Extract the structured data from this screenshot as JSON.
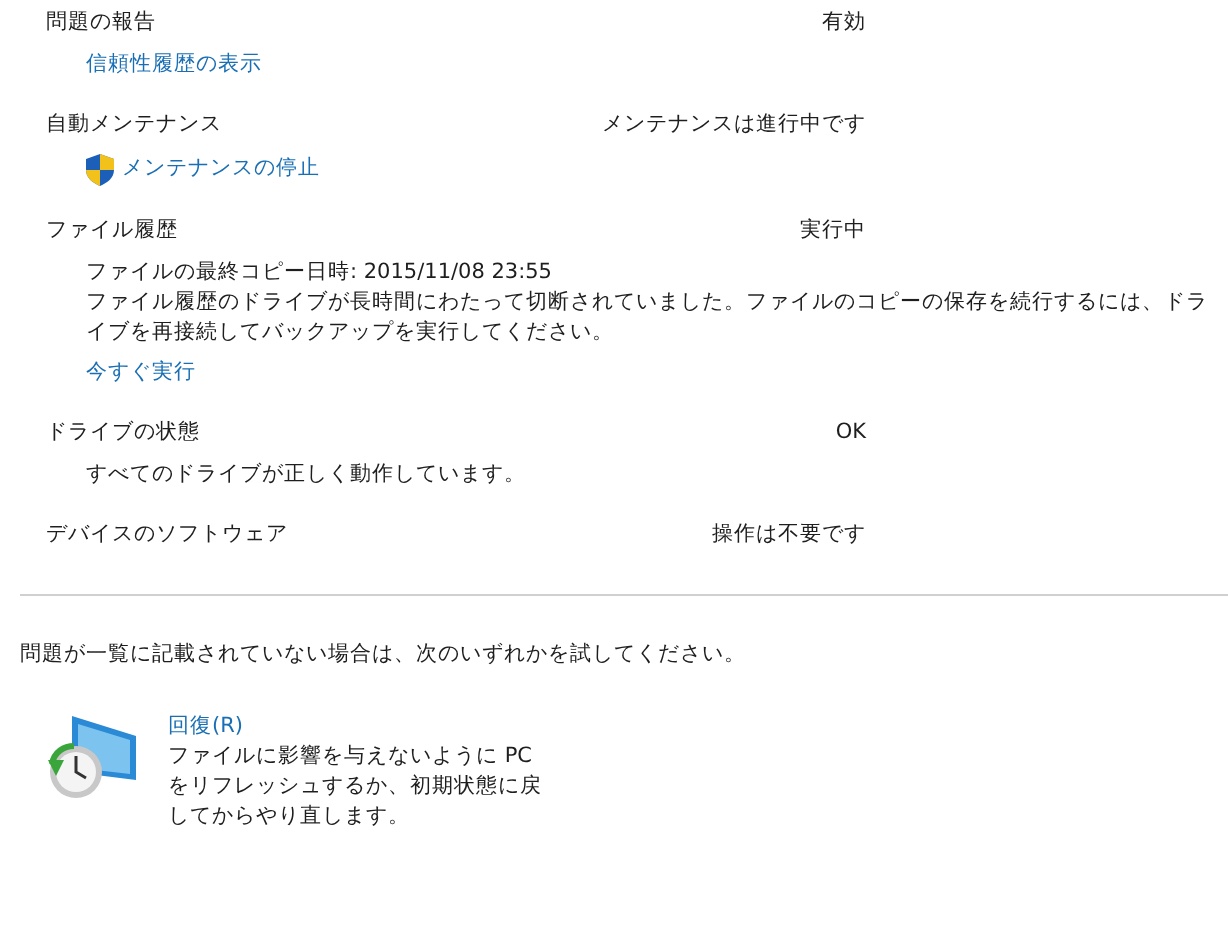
{
  "sections": [
    {
      "label": "問題の報告",
      "status": "有効",
      "items": [
        {
          "kind": "link",
          "text": "信頼性履歴の表示"
        }
      ]
    },
    {
      "label": "自動メンテナンス",
      "status": "メンテナンスは進行中です",
      "items": [
        {
          "kind": "shield-link",
          "text": "メンテナンスの停止"
        }
      ]
    },
    {
      "label": "ファイル履歴",
      "status": "実行中",
      "items": [
        {
          "kind": "text",
          "text": "ファイルの最終コピー日時: 2015/11/08 23:55"
        },
        {
          "kind": "text",
          "text": "ファイル履歴のドライブが長時間にわたって切断されていました。ファイルのコピーの保存を続行するには、ドライブを再接続してバックアップを実行してください。"
        },
        {
          "kind": "link",
          "text": "今すぐ実行"
        }
      ]
    },
    {
      "label": "ドライブの状態",
      "status": "OK",
      "items": [
        {
          "kind": "text",
          "text": "すべてのドライブが正しく動作しています。"
        }
      ]
    },
    {
      "label": "デバイスのソフトウェア",
      "status": "操作は不要です"
    }
  ],
  "hint": "問題が一覧に記載されていない場合は、次のいずれかを試してください。",
  "options": [
    {
      "title": "回復(R)",
      "description": "ファイルに影響を与えないように PC をリフレッシュするか、初期状態に戻してからやり直します。"
    }
  ]
}
